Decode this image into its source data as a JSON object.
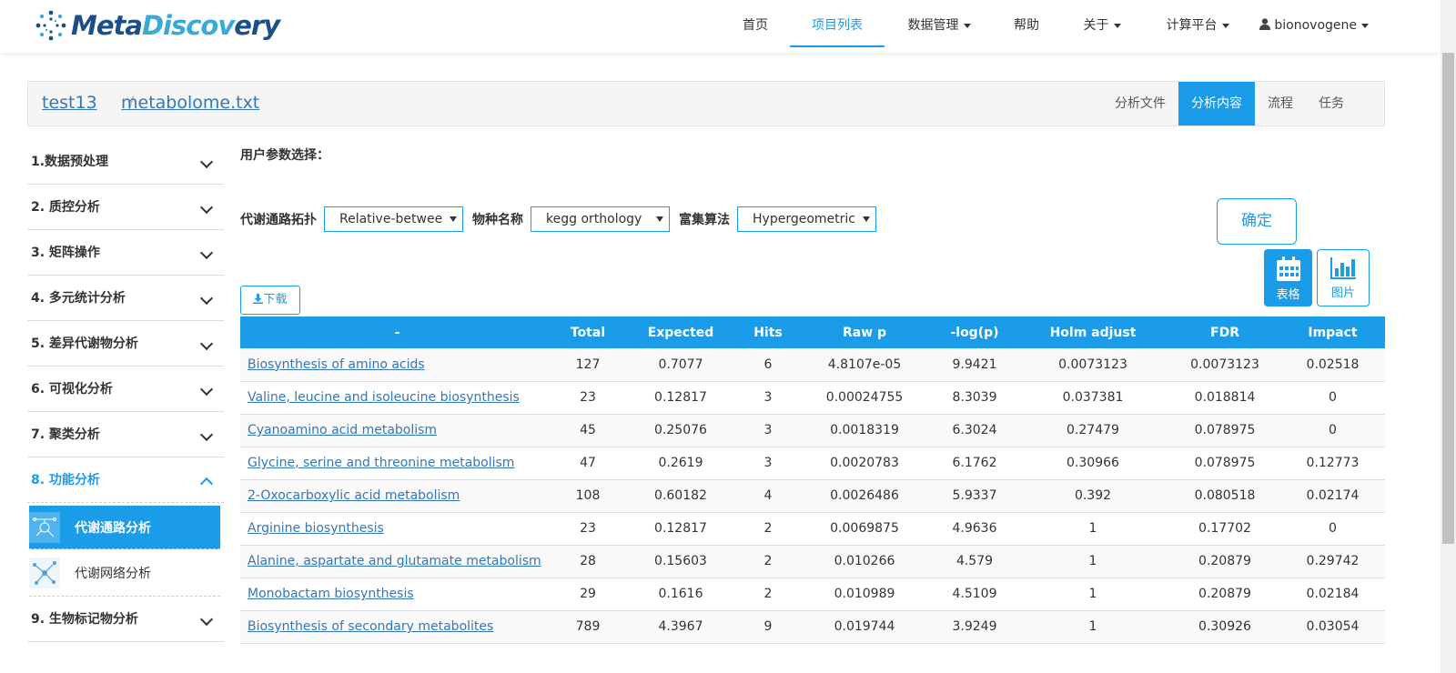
{
  "brand": {
    "part1": "Meta",
    "part2": "Discovery",
    "part2_accent": "Discov",
    "part2_end": "ery"
  },
  "nav": {
    "items": [
      "首页",
      "项目列表",
      "数据管理",
      "帮助",
      "关于",
      "计算平台"
    ],
    "active_index": 1,
    "user": "bionovogene"
  },
  "breadcrumb": {
    "project": "test13",
    "file": "metabolome.txt",
    "sep": "/"
  },
  "tabs": [
    "分析文件",
    "分析内容",
    "流程",
    "任务"
  ],
  "active_tab": 1,
  "sidebar": {
    "items": [
      {
        "label": "1.数据预处理"
      },
      {
        "label": "2. 质控分析"
      },
      {
        "label": "3. 矩阵操作"
      },
      {
        "label": "4. 多元统计分析"
      },
      {
        "label": "5. 差异代谢物分析"
      },
      {
        "label": "6. 可视化分析"
      },
      {
        "label": "7. 聚类分析"
      },
      {
        "label": "8. 功能分析"
      },
      {
        "label": "9. 生物标记物分析"
      }
    ],
    "open_index": 7,
    "sub_items": [
      {
        "label": "代谢通路分析",
        "active": true
      },
      {
        "label": "代谢网络分析",
        "active": false
      }
    ]
  },
  "params": {
    "title": "用户参数选择：",
    "topology_label": "代谢通路拓扑",
    "topology_value": "Relative-betwee",
    "species_label": "物种名称",
    "species_value": "kegg orthology",
    "enrich_label": "富集算法",
    "enrich_value": "Hypergeometric",
    "confirm": "确定"
  },
  "view": {
    "table_label": "表格",
    "image_label": "图片",
    "active": "table"
  },
  "download_label": "下载",
  "table": {
    "headers": [
      "-",
      "Total",
      "Expected",
      "Hits",
      "Raw p",
      "-log(p)",
      "Holm adjust",
      "FDR",
      "Impact"
    ],
    "rows": [
      [
        "Biosynthesis of amino acids",
        "127",
        "0.7077",
        "6",
        "4.8107e-05",
        "9.9421",
        "0.0073123",
        "0.0073123",
        "0.02518"
      ],
      [
        "Valine, leucine and isoleucine biosynthesis",
        "23",
        "0.12817",
        "3",
        "0.00024755",
        "8.3039",
        "0.037381",
        "0.018814",
        "0"
      ],
      [
        "Cyanoamino acid metabolism",
        "45",
        "0.25076",
        "3",
        "0.0018319",
        "6.3024",
        "0.27479",
        "0.078975",
        "0"
      ],
      [
        "Glycine, serine and threonine metabolism",
        "47",
        "0.2619",
        "3",
        "0.0020783",
        "6.1762",
        "0.30966",
        "0.078975",
        "0.12773"
      ],
      [
        "2-Oxocarboxylic acid metabolism",
        "108",
        "0.60182",
        "4",
        "0.0026486",
        "5.9337",
        "0.392",
        "0.080518",
        "0.02174"
      ],
      [
        "Arginine biosynthesis",
        "23",
        "0.12817",
        "2",
        "0.0069875",
        "4.9636",
        "1",
        "0.17702",
        "0"
      ],
      [
        "Alanine, aspartate and glutamate metabolism",
        "28",
        "0.15603",
        "2",
        "0.010266",
        "4.579",
        "1",
        "0.20879",
        "0.29742"
      ],
      [
        "Monobactam biosynthesis",
        "29",
        "0.1616",
        "2",
        "0.010989",
        "4.5109",
        "1",
        "0.20879",
        "0.02184"
      ],
      [
        "Biosynthesis of secondary metabolites",
        "789",
        "4.3967",
        "9",
        "0.019744",
        "3.9249",
        "1",
        "0.30926",
        "0.03054"
      ]
    ]
  },
  "colors": {
    "accent": "#1a9ce8",
    "link": "#3377b8",
    "brand_dark": "#1b4f8a"
  }
}
